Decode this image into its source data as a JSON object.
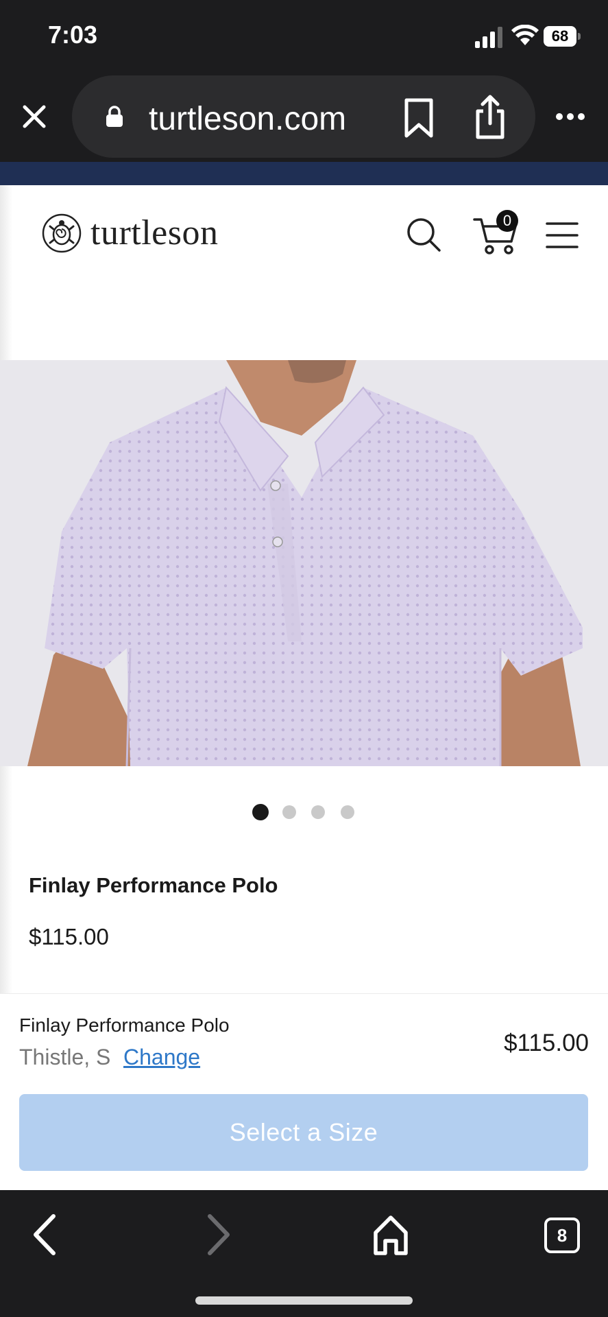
{
  "status_bar": {
    "time": "7:03",
    "battery": "68"
  },
  "browser": {
    "url": "turtleson.com",
    "tab_count": "8"
  },
  "site": {
    "logo_text": "turtleson",
    "cart_count": "0"
  },
  "product": {
    "title": "Finlay Performance Polo",
    "price": "$115.00",
    "image_count": 4,
    "active_image_index": 0
  },
  "sticky_bar": {
    "title": "Finlay Performance Polo",
    "variant": "Thistle, S",
    "change_label": "Change",
    "price": "$115.00",
    "cta_label": "Select a Size"
  },
  "colors": {
    "accent_link": "#2e78c8",
    "cta_disabled": "#b3cff0",
    "promo_strip": "#1f2f54",
    "shirt": "#d7cfe8"
  }
}
